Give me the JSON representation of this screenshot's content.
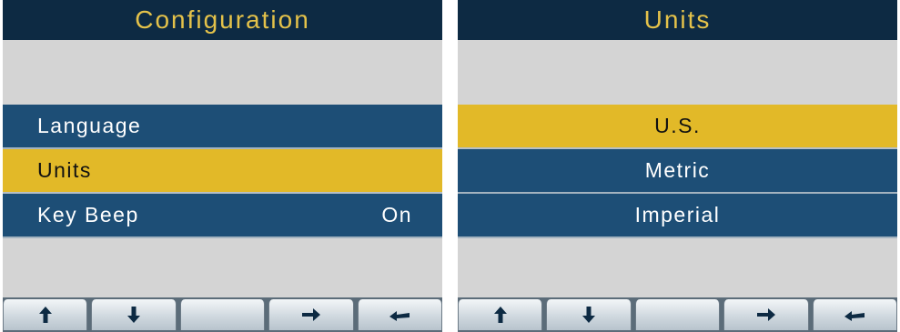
{
  "screens": [
    {
      "title": "Configuration",
      "items": [
        {
          "label": "Language",
          "value": ""
        },
        {
          "label": "Units",
          "value": ""
        },
        {
          "label": "Key Beep",
          "value": "On"
        }
      ],
      "selected_index": 1,
      "softkeys": [
        "up-arrow-icon",
        "down-arrow-icon",
        "blank",
        "right-arrow-icon",
        "back-arrow-icon"
      ]
    },
    {
      "title": "Units",
      "items": [
        {
          "label": "U.S."
        },
        {
          "label": "Metric"
        },
        {
          "label": "Imperial"
        }
      ],
      "selected_index": 0,
      "softkeys": [
        "up-arrow-icon",
        "down-arrow-icon",
        "blank",
        "right-arrow-icon",
        "back-arrow-icon"
      ]
    }
  ],
  "colors": {
    "title_bg": "#0d2a43",
    "title_text": "#e4c24a",
    "row_bg": "#1d4e76",
    "selected_bg": "#e2b928",
    "screen_bg": "#d4d4d4"
  }
}
